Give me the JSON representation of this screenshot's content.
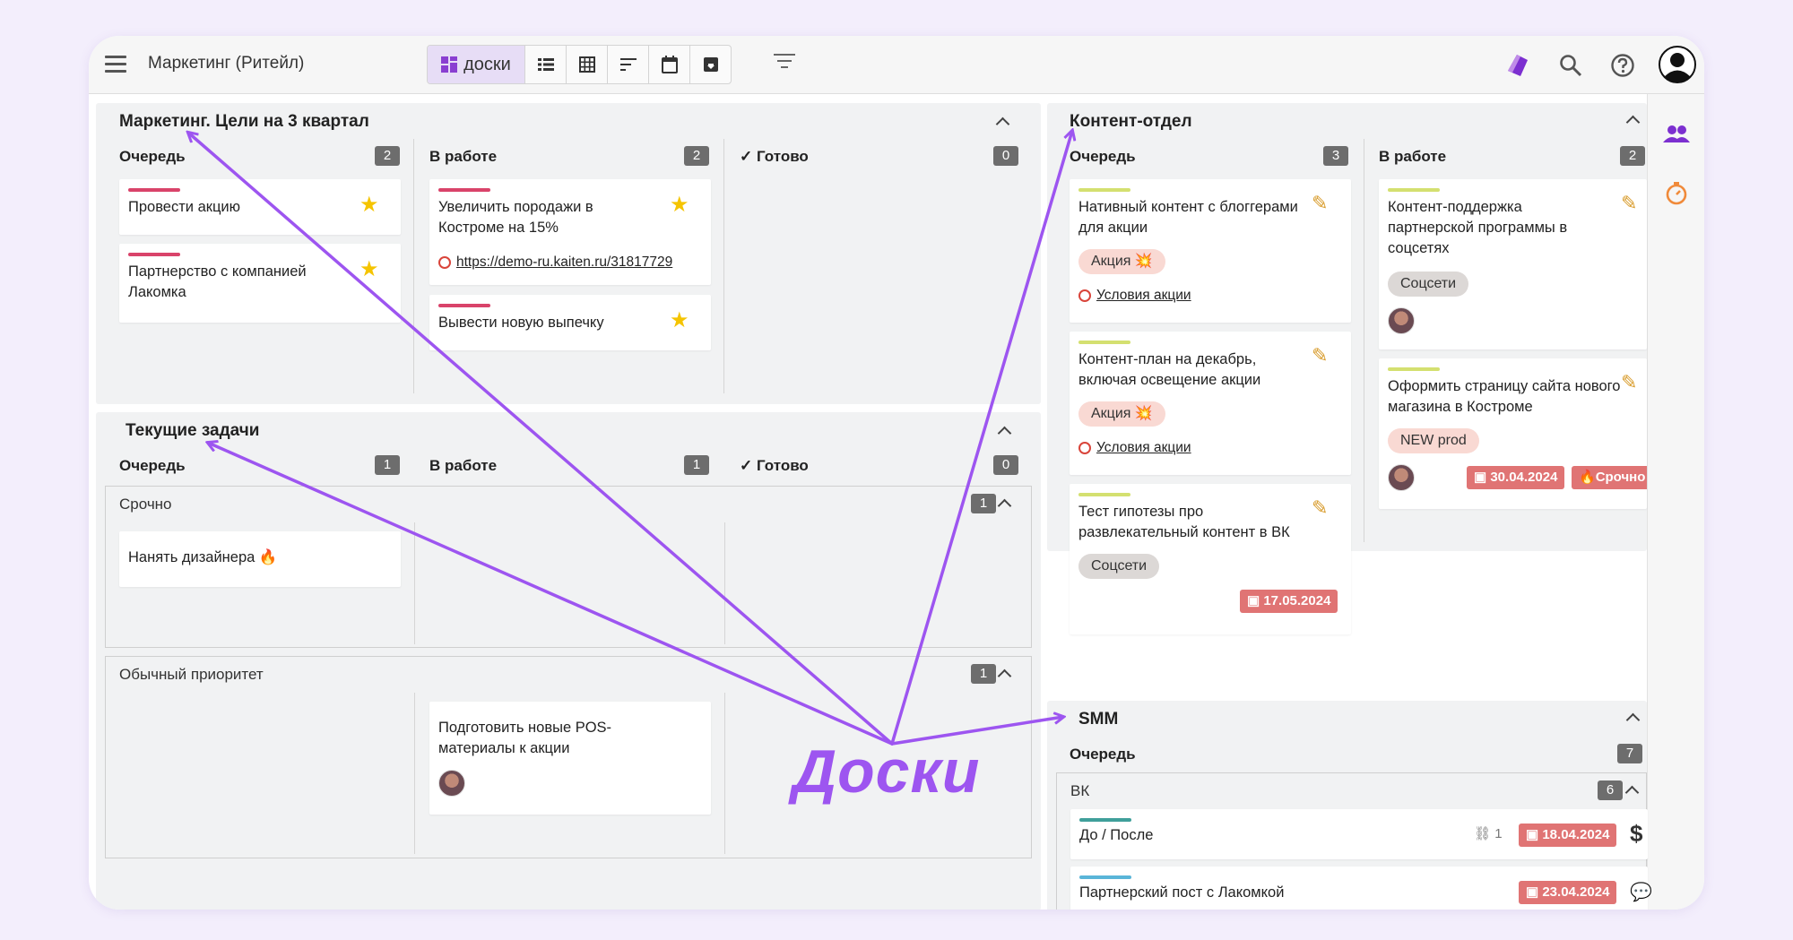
{
  "topbar": {
    "space_title": "Маркетинг (Ритейл)",
    "views": [
      "доски",
      "list-icon",
      "table-icon",
      "timeline-icon",
      "calendar-icon",
      "archive-icon"
    ],
    "active_view_label": "доски"
  },
  "boards": {
    "goals": {
      "title": "Маркетинг. Цели на 3 квартал",
      "columns": [
        {
          "name": "Очередь",
          "count": "2"
        },
        {
          "name": "В работе",
          "count": "2"
        },
        {
          "name": "Готово",
          "count": "0"
        }
      ],
      "cards": [
        {
          "title": "Провести акцию"
        },
        {
          "title": "Партнерство с компанией Лакомка"
        },
        {
          "title": "Увеличить породажи в Костроме на 15%",
          "link": "https://demo-ru.kaiten.ru/31817729"
        },
        {
          "title": "Вывести новую выпечку"
        }
      ]
    },
    "current": {
      "title": "Текущие задачи",
      "columns": [
        {
          "name": "Очередь",
          "count": "1"
        },
        {
          "name": "В работе",
          "count": "1"
        },
        {
          "name": "Готово",
          "count": "0"
        }
      ],
      "lanes": [
        {
          "name": "Срочно",
          "count": "1"
        },
        {
          "name": "Обычный приоритет",
          "count": "1"
        }
      ],
      "cards": [
        {
          "title": "Нанять дизайнера 🔥"
        },
        {
          "title": "Подготовить новые POS-материалы к акции"
        }
      ]
    },
    "content": {
      "title": "Контент-отдел",
      "columns": [
        {
          "name": "Очередь",
          "count": "3"
        },
        {
          "name": "В работе",
          "count": "2"
        }
      ],
      "cards": [
        {
          "title": "Нативный контент с блоггерами для акции",
          "tag": "Акция 💥",
          "link": "Условия акции"
        },
        {
          "title": "Контент-план на декабрь, включая освещение акции",
          "tag": "Акция 💥",
          "link": "Условия акции"
        },
        {
          "title": "Тест гипотезы про развлекательный контент в ВК",
          "tag": "Соцсети",
          "date": "17.05.2024"
        },
        {
          "title": "Контент-поддержка партнерской программы в соцсетях",
          "tag": "Соцсети"
        },
        {
          "title": "Оформить страницу сайта нового магазина в Костроме",
          "tag": "NEW prod",
          "date": "30.04.2024",
          "urgent": "Срочно"
        }
      ]
    },
    "smm": {
      "title": "SMM",
      "column": {
        "name": "Очередь",
        "count": "7"
      },
      "lane": {
        "name": "ВК",
        "count": "6"
      },
      "cards": [
        {
          "title": "До / После",
          "links": "1",
          "date": "18.04.2024",
          "extra": "$"
        },
        {
          "title": "Партнерский пост с Лакомкой",
          "date": "23.04.2024"
        }
      ]
    }
  },
  "annotation": "Доски",
  "colors": {
    "accent": "#9d55f0",
    "red_bar": "#d9436a",
    "yellow_bar": "#d4e070",
    "teal_bar": "#3f9f9a",
    "blue_bar": "#5ab5d8",
    "date_badge": "#e07474"
  }
}
